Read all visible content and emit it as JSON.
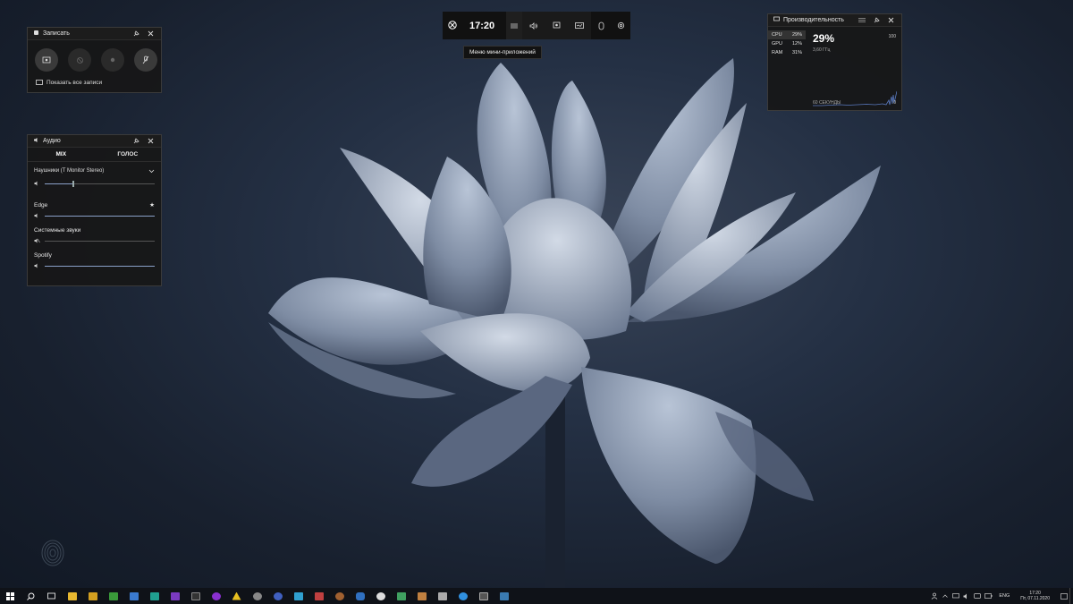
{
  "capture": {
    "title": "Записать",
    "show_all_label": "Показать все записи"
  },
  "audio": {
    "title": "Аудио",
    "tabs": [
      "MIX",
      "ГОЛОС"
    ],
    "device": "Наушники (T Monitor Stereo)",
    "apps": [
      {
        "name": "Edge",
        "level": 1.0
      },
      {
        "name": "Системные звуки",
        "level": 0.0
      },
      {
        "name": "Spotify",
        "level": 1.0
      }
    ],
    "master_level": 0.25
  },
  "gamebar": {
    "time": "17:20",
    "tooltip": "Меню мини-приложений"
  },
  "performance": {
    "title": "Производительность",
    "metrics": [
      {
        "label": "CPU",
        "value": "29%"
      },
      {
        "label": "GPU",
        "value": "12%"
      },
      {
        "label": "RAM",
        "value": "31%"
      }
    ],
    "big_value": "29%",
    "sub_value": "3,60 ГГц",
    "max_label": "100",
    "footer_label": "60 СЕКУНДЫ",
    "zero_label": "0"
  },
  "taskbar": {
    "lang": "ENG",
    "time": "17:20",
    "date": "Пт, 07.11.2020",
    "icons": [
      "windows-start",
      "search",
      "task-view",
      "file-explorer",
      "app-folder",
      "app-green",
      "app-check",
      "app-teal",
      "app-purple",
      "app-terminal",
      "app-firefox-like",
      "app-warning",
      "app-gray-circle",
      "app-blue-circle",
      "app-cube",
      "app-pointer",
      "app-tree",
      "app-shield",
      "app-gear-circle",
      "app-image",
      "app-pen",
      "app-brush",
      "app-wing",
      "app-monitor",
      "app-window"
    ]
  },
  "colors": {
    "widget_bg": "#171717",
    "accent": "#8aa0c8",
    "taskbar": "#0f1218"
  }
}
